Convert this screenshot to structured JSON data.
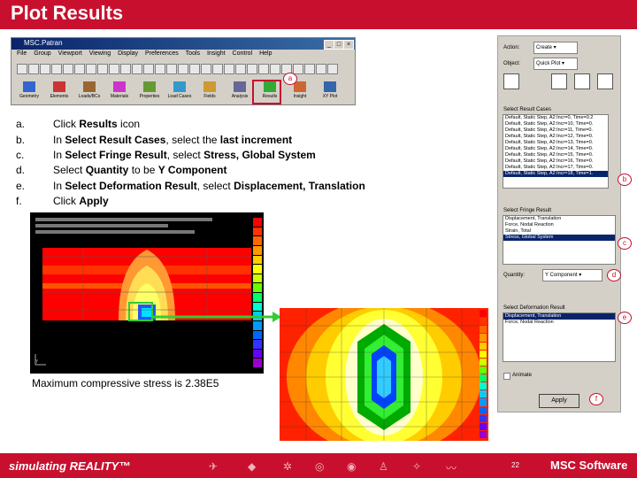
{
  "header": {
    "title": "Plot Results"
  },
  "patran": {
    "title": "MSC.Patran",
    "menu": [
      "File",
      "Group",
      "Viewport",
      "Viewing",
      "Display",
      "Preferences",
      "Tools",
      "Insight",
      "Control",
      "Help"
    ],
    "apps": [
      "Geometry",
      "Elements",
      "Loads/BCs",
      "Materials",
      "Properties",
      "Load Cases",
      "Fields",
      "Analysis",
      "Results",
      "Insight",
      "XY Plot"
    ]
  },
  "steps": [
    {
      "key": "a.",
      "pre": "Click ",
      "b1": "Results",
      "mid": " icon",
      "b2": "",
      "end": ""
    },
    {
      "key": "b.",
      "pre": "In ",
      "b1": "Select Result Cases",
      "mid": ", select the ",
      "b2": "last increment",
      "end": ""
    },
    {
      "key": "c.",
      "pre": "In ",
      "b1": "Select Fringe Result",
      "mid": ", select ",
      "b2": "Stress, Global System",
      "end": ""
    },
    {
      "key": "d.",
      "pre": "Select ",
      "b1": "Quantity",
      "mid": " to be ",
      "b2": "Y Component",
      "end": ""
    },
    {
      "key": "e.",
      "pre": "In ",
      "b1": "Select Deformation Result",
      "mid": ", select ",
      "b2": "Displacement, Translation",
      "end": ""
    },
    {
      "key": "f.",
      "pre": "Click ",
      "b1": "Apply",
      "mid": "",
      "b2": "",
      "end": ""
    }
  ],
  "panel": {
    "action_label": "Action:",
    "action_value": "Create",
    "object_label": "Object:",
    "object_value": "Quick Plot",
    "result_cases_label": "Select Result Cases",
    "result_cases": [
      "Default, Static Step, A2:Incr=0, Time=0.2",
      "Default, Static Step, A2:Incr=10, Time=0.",
      "Default, Static Step, A2:Incr=11, Time=0.",
      "Default, Static Step, A2:Incr=12, Time=0.",
      "Default, Static Step, A2:Incr=13, Time=0.",
      "Default, Static Step, A2:Incr=14, Time=0.",
      "Default, Static Step, A2:Incr=15, Time=0.",
      "Default, Static Step, A2:Incr=16, Time=0.",
      "Default, Static Step, A2:Incr=17, Time=0.",
      "Default, Static Step, A2:Incr=18, Time=1."
    ],
    "fringe_label": "Select Fringe Result",
    "fringe": [
      "Displacement, Translation",
      "Force, Nodal Reaction",
      "Strain, Total",
      "Stress, Global System"
    ],
    "quantity_label": "Quantity:",
    "quantity_value": "Y Component",
    "deformation_label": "Select Deformation Result",
    "deformation": [
      "Displacement, Translation",
      "Force, Nodal Reaction"
    ],
    "animate_label": "Animate",
    "apply_label": "Apply"
  },
  "callouts": [
    "a",
    "b",
    "c",
    "d",
    "e",
    "f"
  ],
  "caption": "Maximum compressive stress is 2.38E5",
  "footer": {
    "brand": "simulating REALITY™",
    "page": "22",
    "logo": "MSC Software"
  }
}
